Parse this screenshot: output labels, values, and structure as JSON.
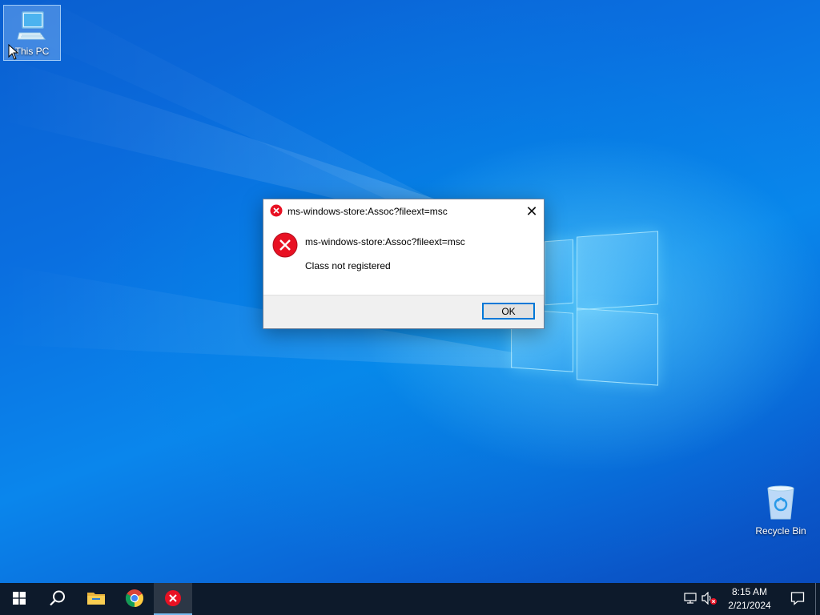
{
  "desktop": {
    "icons": [
      {
        "label": "This PC",
        "icon": "computer-icon"
      },
      {
        "label": "Recycle Bin",
        "icon": "recycle-bin-icon"
      }
    ]
  },
  "dialog": {
    "title": "ms-windows-store:Assoc?fileext=msc",
    "message": "ms-windows-store:Assoc?fileext=msc",
    "detail": "Class not registered",
    "ok_label": "OK",
    "close_glyph": "✕",
    "icon": "error-icon"
  },
  "taskbar": {
    "items": [
      {
        "name": "start",
        "icon": "windows-start-icon"
      },
      {
        "name": "search",
        "icon": "search-icon"
      },
      {
        "name": "file-explorer",
        "icon": "folder-icon"
      },
      {
        "name": "chrome",
        "icon": "chrome-icon"
      },
      {
        "name": "error-dialog",
        "icon": "error-icon",
        "active": true
      }
    ],
    "tray": {
      "network_icon": "network-icon",
      "volume_icon": "volume-muted-icon",
      "time": "8:15 AM",
      "date": "2/21/2024",
      "notification_icon": "notification-icon"
    }
  },
  "colors": {
    "accent": "#0078d7",
    "error_red": "#e81123",
    "taskbar_bg": "#0d1a2b"
  }
}
